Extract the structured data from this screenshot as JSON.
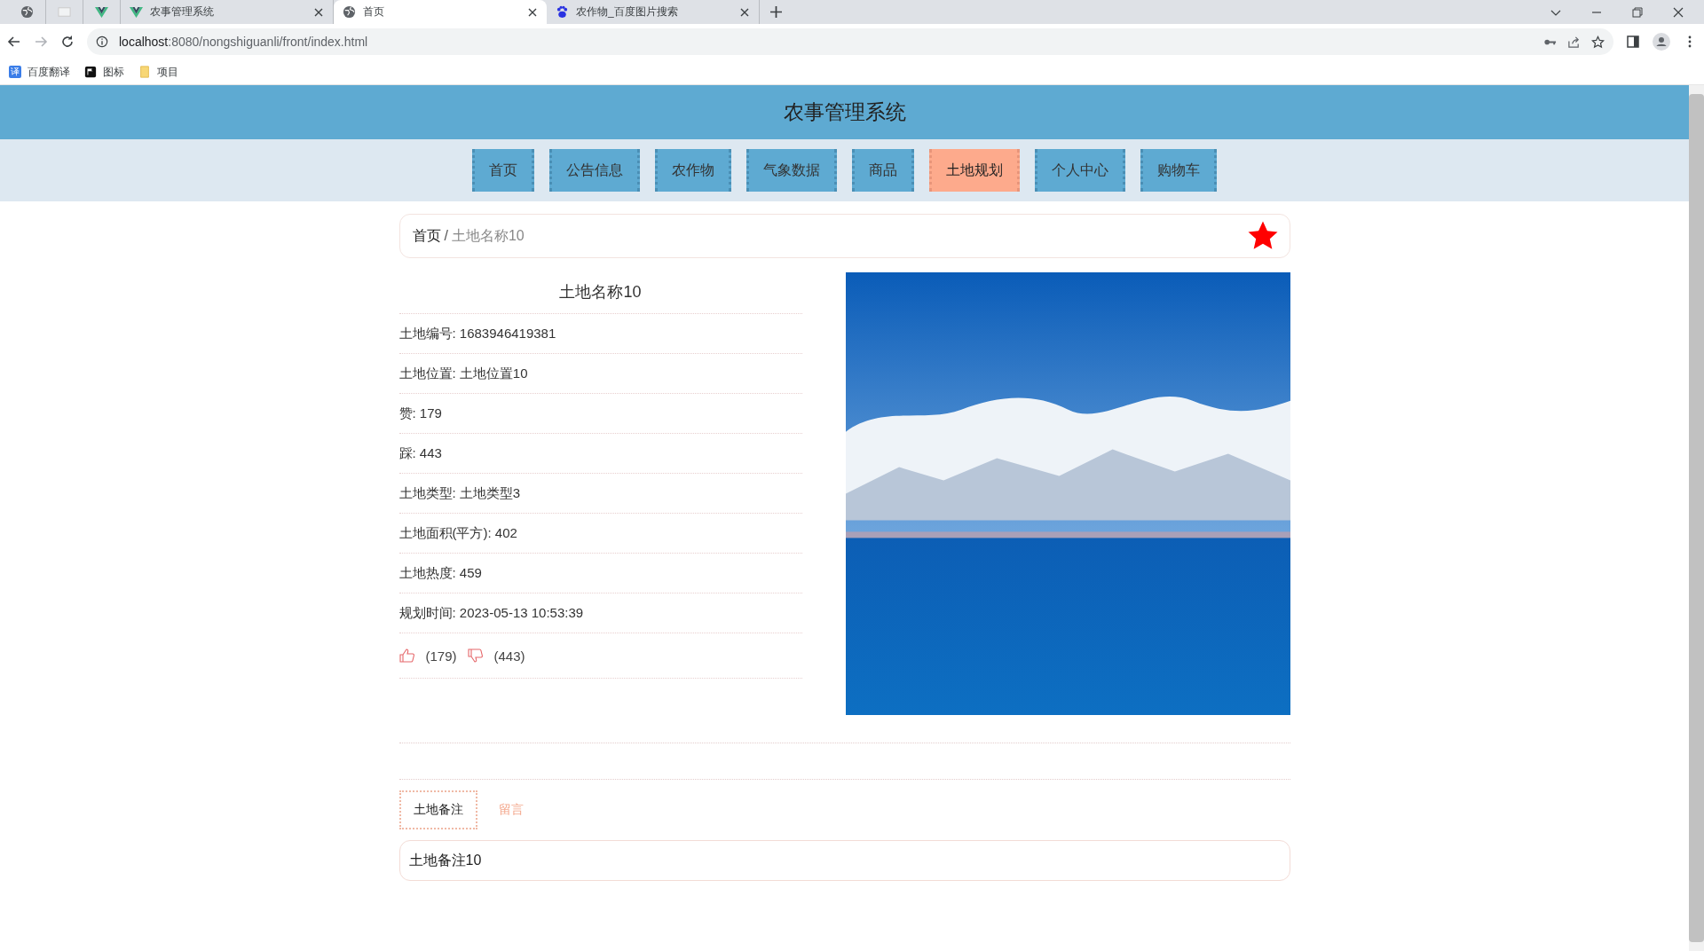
{
  "browser": {
    "tabs": [
      {
        "kind": "globe",
        "selected": false
      },
      {
        "kind": "page",
        "selected": false
      },
      {
        "kind": "vue",
        "selected": false
      },
      {
        "kind": "vue",
        "title": "农事管理系统",
        "selected": false
      },
      {
        "kind": "globe",
        "title": "首页",
        "selected": true
      },
      {
        "kind": "paw",
        "title": "农作物_百度图片搜索",
        "selected": false
      }
    ],
    "url_host": "localhost",
    "url_rest": ":8080/nongshiguanli/front/index.html",
    "bookmarks": [
      {
        "kind": "translate",
        "icon_text": "译",
        "label": "百度翻译"
      },
      {
        "kind": "flag",
        "label": "图标"
      },
      {
        "kind": "folder",
        "label": "项目"
      }
    ]
  },
  "site": {
    "title": "农事管理系统",
    "nav": [
      {
        "label": "首页",
        "selected": false
      },
      {
        "label": "公告信息",
        "selected": false
      },
      {
        "label": "农作物",
        "selected": false
      },
      {
        "label": "气象数据",
        "selected": false
      },
      {
        "label": "商品",
        "selected": false
      },
      {
        "label": "土地规划",
        "selected": true
      },
      {
        "label": "个人中心",
        "selected": false
      },
      {
        "label": "购物车",
        "selected": false
      }
    ]
  },
  "breadcrumb": {
    "home": "首页",
    "separator": "/",
    "current": "土地名称10"
  },
  "detail": {
    "title": "土地名称10",
    "fields": [
      "土地编号: 1683946419381",
      "土地位置: 土地位置10",
      "赞: 179",
      "踩: 443",
      "土地类型: 土地类型3",
      "土地面积(平方): 402",
      "土地热度: 459",
      "规划时间: 2023-05-13 10:53:39"
    ],
    "likes": "(179)",
    "dislikes": "(443)"
  },
  "bottom_tabs": [
    {
      "label": "土地备注",
      "selected": true
    },
    {
      "label": "留言",
      "selected": false
    }
  ],
  "remark": "土地备注10"
}
